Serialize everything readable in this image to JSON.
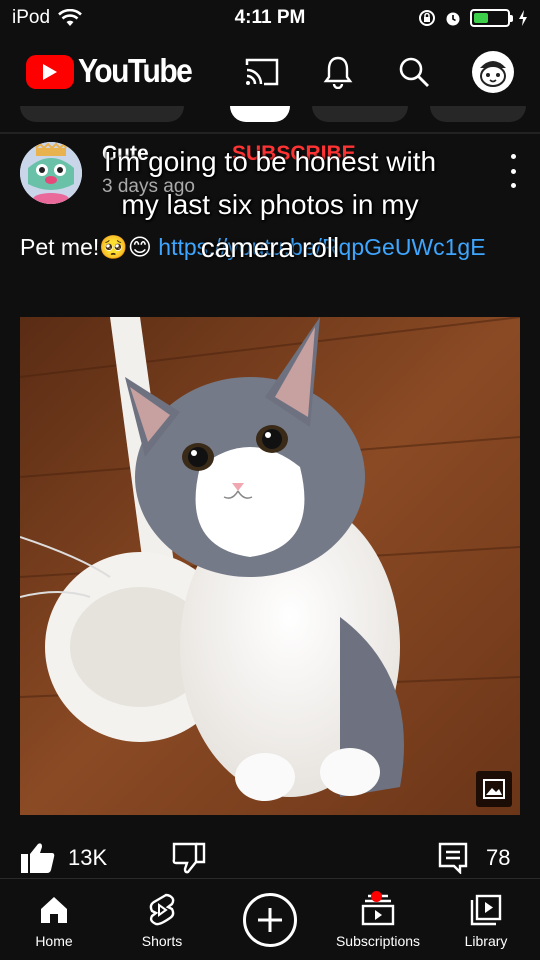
{
  "status_bar": {
    "carrier": "iPod",
    "time": "4:11 PM",
    "battery_color": "#3ecf4a"
  },
  "header": {
    "logo_text": "YouTube",
    "icons": [
      "cast-icon",
      "bell-icon",
      "search-icon",
      "account-avatar"
    ]
  },
  "post": {
    "channel_name": "Cute",
    "subscribe_label": "SUBSCRIBE",
    "time_ago": "3 days ago",
    "text_prefix": "Pet me!",
    "text_emoji": "🥺😊",
    "link_text": "https://youtu.be/RqpGeUWc1gE",
    "likes": "13K",
    "comments": "78"
  },
  "overlay_caption": "I'm going to be honest with my last six photos in my camera roll",
  "bottom_nav": {
    "items": [
      {
        "label": "Home",
        "icon": "home-icon"
      },
      {
        "label": "Shorts",
        "icon": "shorts-icon"
      },
      {
        "label": "",
        "icon": "create-icon"
      },
      {
        "label": "Subscriptions",
        "icon": "subscriptions-icon"
      },
      {
        "label": "Library",
        "icon": "library-icon"
      }
    ]
  },
  "colors": {
    "background": "#0f0f0f",
    "brand_red": "#ff0000",
    "link_blue": "#3ea6ff"
  }
}
